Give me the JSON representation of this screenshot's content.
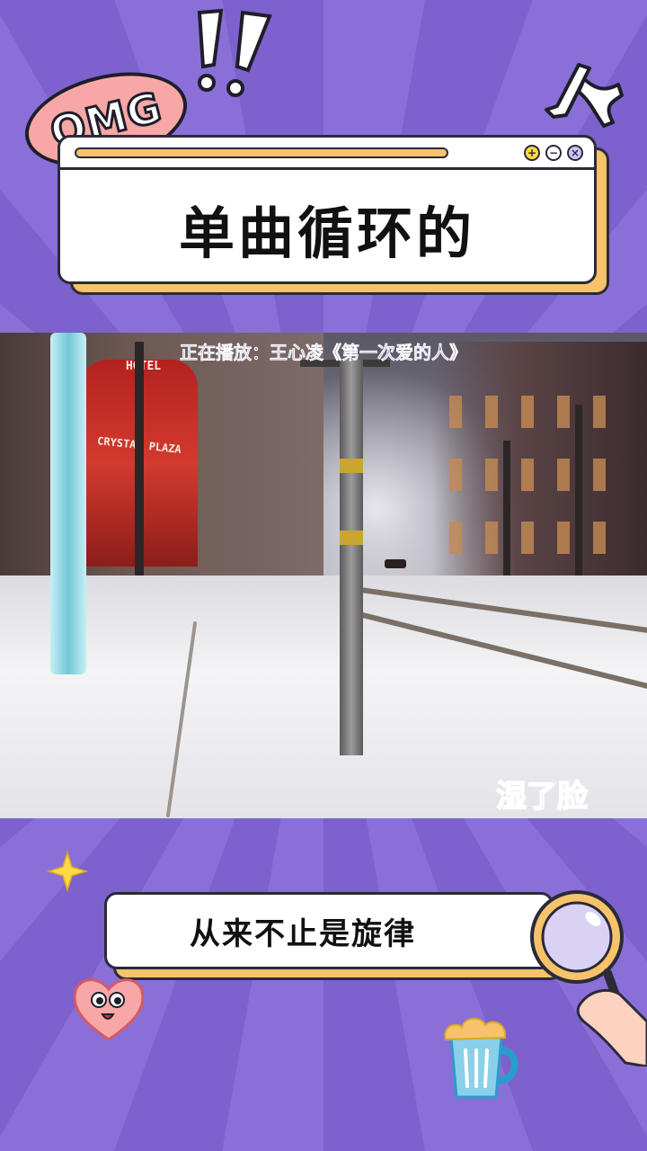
{
  "badge": {
    "text": "OMG"
  },
  "card": {
    "title": "单曲循环的",
    "buttons": {
      "plus": "+",
      "minus": "−",
      "close": "×"
    }
  },
  "video": {
    "now_playing": "正在播放：王心凌《第一次爱的人》",
    "lyric": "湿了脸",
    "sign_top": "HOTEL",
    "sign": "CRYSTAL PLAZA"
  },
  "search": {
    "text": "从来不止是旋律"
  },
  "colors": {
    "background": "#8a6fd6",
    "accent_yellow": "#f6c26a",
    "badge_pink": "#f7a7a6",
    "outline": "#2a2a3a",
    "now_playing_blue": "#2e3fb6",
    "lyric_purple": "#3a2d88"
  },
  "icons": {
    "exclaim": "double-exclamation-icon",
    "human": "human-character-icon",
    "star": "star-icon",
    "heart": "heart-face-icon",
    "magnifier": "magnifier-hand-icon",
    "beer": "beer-mug-icon"
  }
}
